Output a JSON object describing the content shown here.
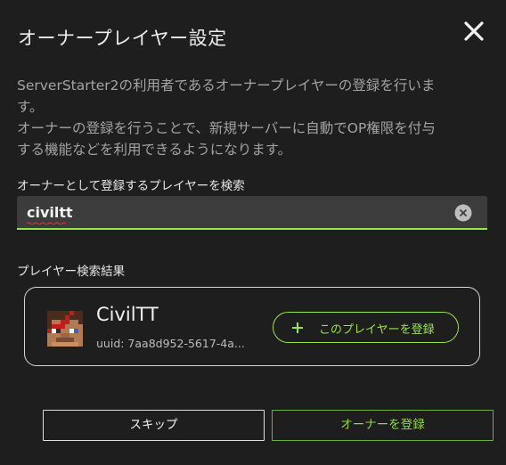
{
  "dialog": {
    "title": "オーナープレイヤー設定",
    "close_icon": "close-icon",
    "description_lines": [
      "ServerStarter2の利用者であるオーナープレイヤーの登録を行いま",
      "す。",
      "オーナーの登録を行うことで、新規サーバーに自動でOP権限を付与",
      "する機能などを利用できるようになります。"
    ]
  },
  "search": {
    "label": "オーナーとして登録するプレイヤーを検索",
    "value": "civiltt",
    "clear_icon": "clear-circle-icon",
    "accent_color": "#9be34a"
  },
  "results": {
    "label": "プレイヤー検索結果",
    "player": {
      "name": "CivilTT",
      "uuid": "uuid: 7aa8d952-5617-4a...",
      "avatar_icon": "player-head-avatar",
      "register_label": "このプレイヤーを登録",
      "register_icon": "plus-icon"
    }
  },
  "footer": {
    "skip_label": "スキップ",
    "register_owner_label": "オーナーを登録"
  }
}
